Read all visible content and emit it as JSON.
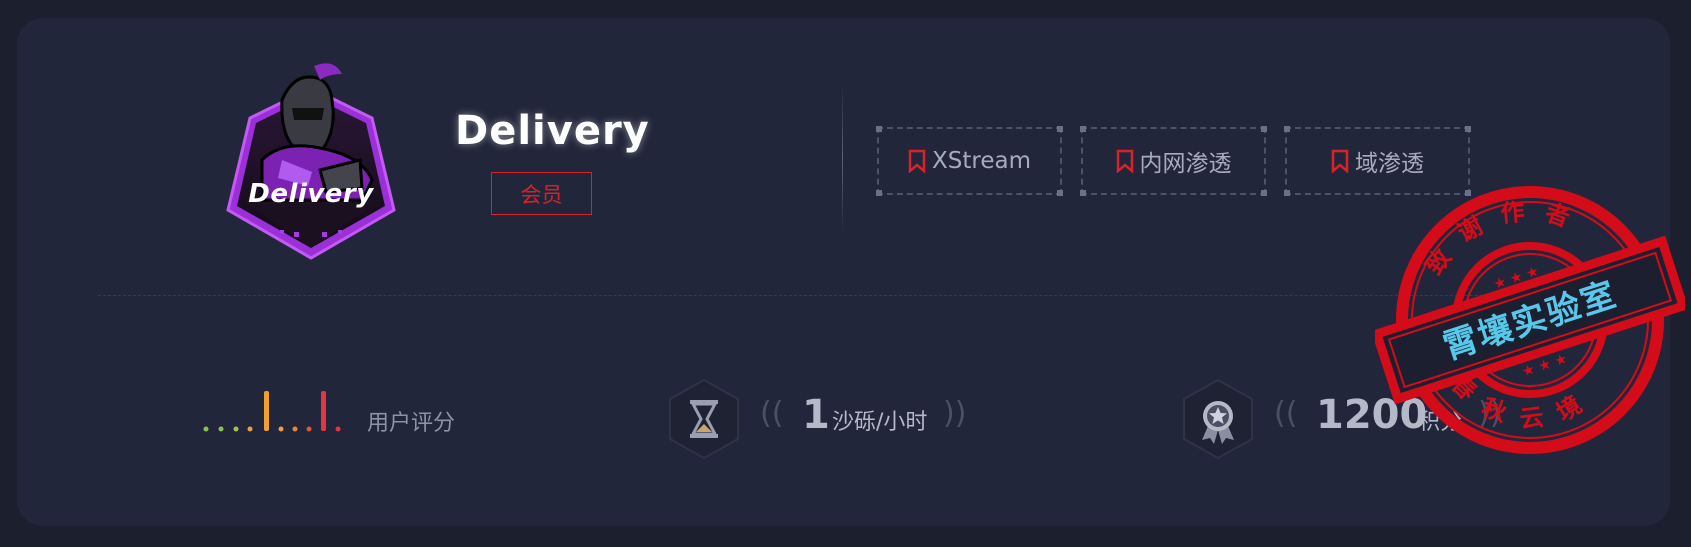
{
  "profile": {
    "logo_text": "Delivery",
    "name": "Delivery",
    "badge": "会员"
  },
  "tags": [
    {
      "label": "XStream",
      "icon": "bookmark-icon"
    },
    {
      "label": "内网渗透",
      "icon": "bookmark-icon"
    },
    {
      "label": "域渗透",
      "icon": "bookmark-icon"
    }
  ],
  "stats": {
    "rating_label": "用户评分",
    "time": {
      "value": "1",
      "unit": "沙砾/小时",
      "icon": "hourglass-icon"
    },
    "points": {
      "value": "1200",
      "unit": "积分",
      "icon": "medal-icon"
    }
  },
  "stamp": {
    "outer_top": "致谢作者",
    "outer_bottom": "春秋云境",
    "banner": "霄壤实验室"
  },
  "colors": {
    "accent_red": "#d7222b",
    "stamp_red": "#d40c1a",
    "banner_cyan": "#58c8ea",
    "card_bg": "#22263a"
  }
}
